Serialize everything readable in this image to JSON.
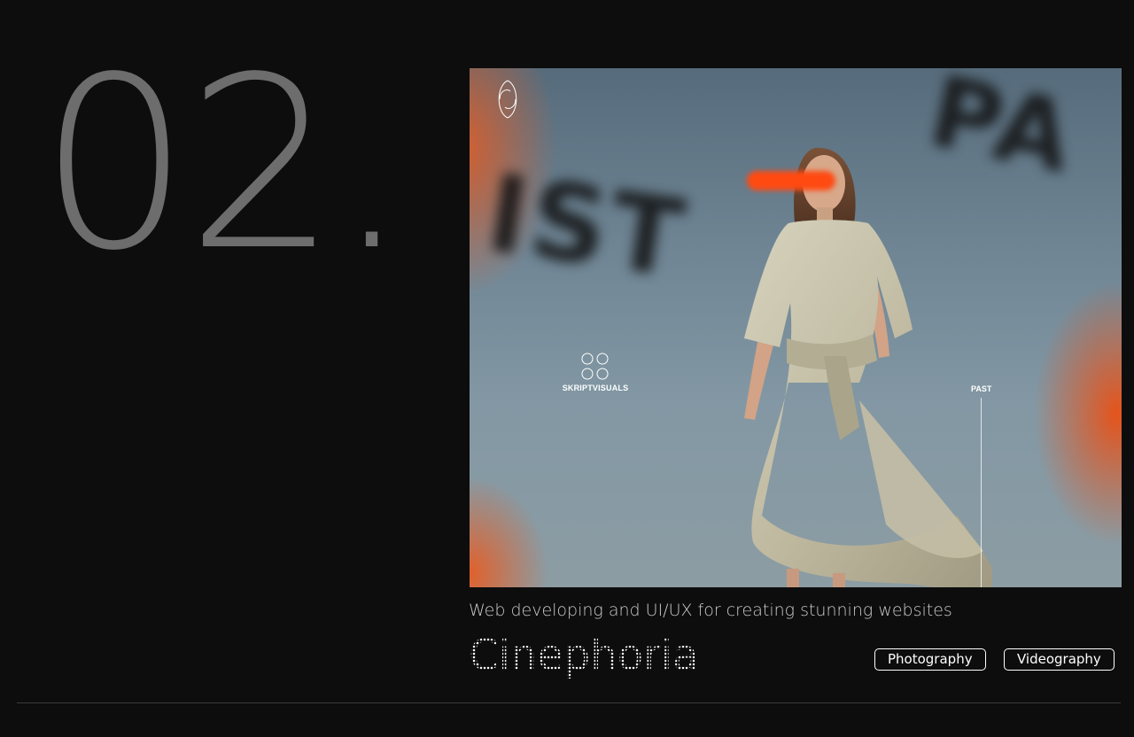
{
  "project": {
    "number": "02.",
    "title": "Cinephoria",
    "description": "Web developing and UI/UX for creating stunning websites",
    "tags": [
      "Photography",
      "Videography"
    ]
  },
  "hero_image": {
    "brand_text": "SKRIPTVISUALS",
    "side_label": "PAST",
    "background_words": [
      "IST",
      "PA"
    ]
  },
  "colors": {
    "background": "#0d0d0d",
    "number": "#6d6d6d",
    "accent": "#ff4a12"
  }
}
